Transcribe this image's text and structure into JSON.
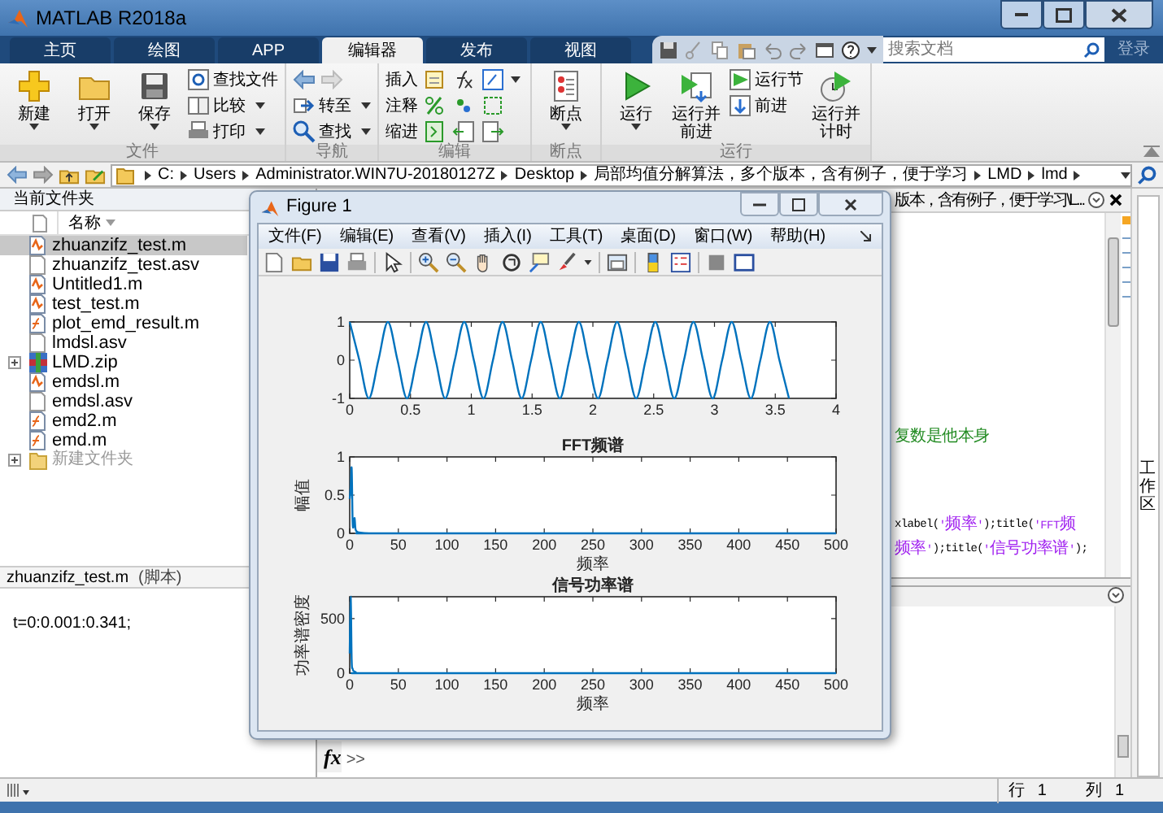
{
  "window": {
    "title": "MATLAB R2018a"
  },
  "tabs": [
    {
      "label": "主页",
      "selected": false
    },
    {
      "label": "绘图",
      "selected": false
    },
    {
      "label": "APP",
      "selected": false
    },
    {
      "label": "编辑器",
      "selected": true
    },
    {
      "label": "发布",
      "selected": false
    },
    {
      "label": "视图",
      "selected": false
    }
  ],
  "search": {
    "placeholder": "搜索文档"
  },
  "login": "登录",
  "ribbon": [
    {
      "label": "文件",
      "items": [
        {
          "kind": "large",
          "label": "新建",
          "dropdown": true
        },
        {
          "kind": "large",
          "label": "打开",
          "dropdown": true
        },
        {
          "kind": "large",
          "label": "保存",
          "dropdown": true
        },
        {
          "kind": "stack",
          "items": [
            {
              "kind": "small",
              "label": "查找文件",
              "dropdown": false
            },
            {
              "kind": "small",
              "label": "比较",
              "dropdown": true
            },
            {
              "kind": "small",
              "label": "打印",
              "dropdown": true
            }
          ]
        }
      ]
    },
    {
      "label": "导航",
      "items": [
        {
          "kind": "stack",
          "items": [
            {
              "kind": "arrows"
            },
            {
              "kind": "small",
              "label": "转至",
              "dropdown": true
            },
            {
              "kind": "small",
              "label": "查找",
              "dropdown": true
            }
          ]
        }
      ]
    },
    {
      "label": "编辑",
      "items": [
        {
          "kind": "stack",
          "items": [
            {
              "kind": "small",
              "label": "插入",
              "dropdown": false
            },
            {
              "kind": "small",
              "label": "注释",
              "dropdown": false
            },
            {
              "kind": "small",
              "label": "缩进",
              "dropdown": false
            }
          ]
        },
        {
          "kind": "icon-grid"
        }
      ]
    },
    {
      "label": "断点",
      "items": [
        {
          "kind": "large",
          "label": "断点",
          "dropdown": true
        }
      ]
    },
    {
      "label": "运行",
      "items": [
        {
          "kind": "large",
          "label": "运行",
          "dropdown": true
        },
        {
          "kind": "large",
          "label": "运行并前进",
          "dropdown": false
        },
        {
          "kind": "stack",
          "items": [
            {
              "kind": "small",
              "label": "运行节",
              "dropdown": false
            },
            {
              "kind": "small",
              "label": "前进",
              "dropdown": false
            }
          ]
        },
        {
          "kind": "large",
          "label": "运行并计时",
          "dropdown": false
        }
      ]
    }
  ],
  "address": {
    "path": [
      "C:",
      "Users",
      "Administrator.WIN7U-20180127Z",
      "Desktop",
      "局部均值分解算法，多个版本，含有例子，便于学习",
      "LMD",
      "lmd"
    ]
  },
  "current_folder": {
    "title": "当前文件夹",
    "column": "名称",
    "items": [
      {
        "name": "zhuanzifz_test.m",
        "kind": "script",
        "selected": true
      },
      {
        "name": "zhuanzifz_test.asv",
        "kind": "asv",
        "selected": false
      },
      {
        "name": "Untitled1.m",
        "kind": "script",
        "selected": false
      },
      {
        "name": "test_test.m",
        "kind": "script",
        "selected": false
      },
      {
        "name": "plot_emd_result.m",
        "kind": "function",
        "selected": false
      },
      {
        "name": "lmdsl.asv",
        "kind": "asv",
        "selected": false
      },
      {
        "name": "LMD.zip",
        "kind": "zip",
        "selected": false
      },
      {
        "name": "emdsl.m",
        "kind": "script",
        "selected": false
      },
      {
        "name": "emdsl.asv",
        "kind": "asv",
        "selected": false
      },
      {
        "name": "emd2.m",
        "kind": "function",
        "selected": false
      },
      {
        "name": "emd.m",
        "kind": "function",
        "selected": false
      },
      {
        "name": "新建文件夹",
        "kind": "folder",
        "selected": false
      }
    ]
  },
  "details": {
    "file": "zhuanzifz_test.m",
    "type": "(脚本)",
    "text": "t=0:0.001:0.341;"
  },
  "editor": {
    "tab_title": "版本，含有例子，便于学习\\L...",
    "lines": [
      [
        {
          "text": "复数是他本身",
          "kind": "comment"
        }
      ],
      [
        {
          "text": "xlabel(",
          "kind": "code"
        },
        {
          "text": "'频率'",
          "kind": "string"
        },
        {
          "text": ");title(",
          "kind": "code"
        },
        {
          "text": "'FFT频",
          "kind": "string"
        }
      ],
      [
        {
          "text": "频率'",
          "kind": "string"
        },
        {
          "text": ");title(",
          "kind": "code"
        },
        {
          "text": "'信号功率谱'",
          "kind": "string"
        },
        {
          "text": ");",
          "kind": "code"
        }
      ]
    ]
  },
  "side_tab": "工作区",
  "command_window": {
    "fx": "fx",
    "prompt": ">>"
  },
  "status_bar": {
    "row_label": "行",
    "row": "1",
    "col_label": "列",
    "col": "1"
  },
  "figure": {
    "title": "Figure 1",
    "menu": [
      "文件(F)",
      "编辑(E)",
      "查看(V)",
      "插入(I)",
      "工具(T)",
      "桌面(D)",
      "窗口(W)",
      "帮助(H)"
    ],
    "plots": [
      {
        "chart_data": {
          "type": "line",
          "x": [
            0,
            0.079,
            0.157,
            0.236,
            0.314,
            0.393,
            0.471,
            0.55,
            0.628,
            0.707,
            0.785,
            0.864,
            0.942,
            1.021,
            1.1,
            1.178,
            1.257,
            1.335,
            1.414,
            1.492,
            1.571,
            1.649,
            1.728,
            1.806,
            1.885,
            1.963,
            2.042,
            2.12,
            2.199,
            2.277,
            2.356,
            2.434,
            2.513,
            2.592,
            2.67,
            2.749,
            2.827,
            2.906,
            2.985,
            3.063,
            3.142,
            3.22,
            3.299,
            3.377,
            3.456,
            3.534,
            3.613
          ],
          "series": [
            {
              "color": "#0072bd",
              "values": [
                1,
                0,
                -1,
                0,
                1,
                0,
                -1,
                0,
                1,
                0,
                -1,
                0,
                1,
                0,
                -1,
                0,
                1,
                0,
                -1,
                0,
                1,
                0,
                -1,
                0,
                1,
                0,
                -1,
                0,
                1,
                0,
                -1,
                0,
                1,
                0,
                -1,
                0,
                1,
                0,
                -1,
                0,
                1,
                0,
                -1,
                0,
                1,
                0,
                -1
              ]
            }
          ],
          "xlim": [
            0,
            4
          ],
          "ylim": [
            -1,
            1
          ],
          "xticks": [
            0,
            0.5,
            1,
            1.5,
            2,
            2.5,
            3,
            3.5,
            4
          ],
          "yticks": [
            -1,
            0,
            1
          ]
        }
      },
      {
        "chart_data": {
          "type": "line",
          "title": "FFT频谱",
          "xlabel": "频率",
          "ylabel": "幅值",
          "x": [
            0,
            1,
            2,
            3,
            4,
            5,
            6,
            8,
            10,
            20,
            50,
            500
          ],
          "series": [
            {
              "color": "#0072bd",
              "values": [
                0.45,
                0.6,
                0.85,
                0.15,
                0.1,
                0.2,
                0.05,
                0.02,
                0.01,
                0,
                0,
                0
              ]
            }
          ],
          "xlim": [
            0,
            500
          ],
          "ylim": [
            0,
            1
          ],
          "xticks": [
            0,
            50,
            100,
            150,
            200,
            250,
            300,
            350,
            400,
            450,
            500
          ],
          "yticks": [
            0,
            0.5,
            1
          ]
        }
      },
      {
        "chart_data": {
          "type": "line",
          "title": "信号功率谱",
          "xlabel": "频率",
          "ylabel": "功率谱密度",
          "x": [
            0,
            1,
            2,
            3,
            4,
            6,
            10,
            50,
            500
          ],
          "series": [
            {
              "color": "#0072bd",
              "values": [
                180,
                700,
                120,
                40,
                20,
                10,
                0,
                0,
                0
              ]
            }
          ],
          "xlim": [
            0,
            500
          ],
          "ylim": [
            0,
            700
          ],
          "xticks": [
            0,
            50,
            100,
            150,
            200,
            250,
            300,
            350,
            400,
            450,
            500
          ],
          "yticks": [
            0,
            500
          ]
        }
      }
    ]
  }
}
